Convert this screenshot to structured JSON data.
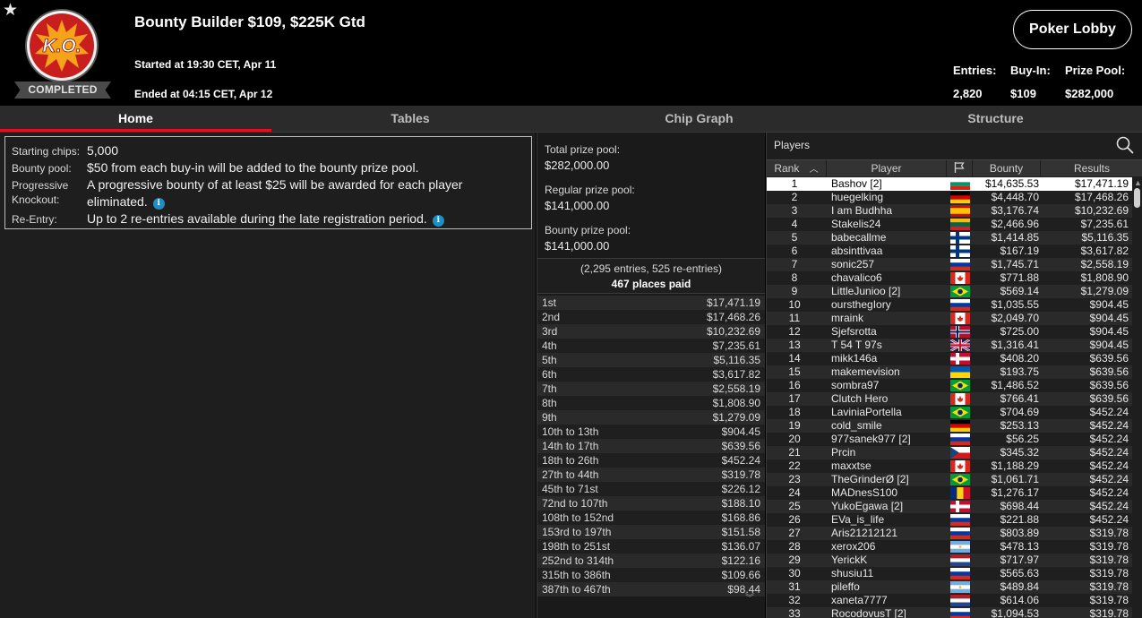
{
  "header": {
    "title": "Bounty Builder $109, $225K Gtd",
    "logo_text": "K.O.",
    "status": "COMPLETED",
    "started": "Started at 19:30 CET, Apr 11",
    "ended": "Ended at 04:15 CET, Apr 12",
    "lobby_button": "Poker Lobby",
    "stats": {
      "entries_label": "Entries:",
      "entries_value": "2,820",
      "buyin_label": "Buy-In:",
      "buyin_value": "$109",
      "prizepool_label": "Prize Pool:",
      "prizepool_value": "$282,000"
    }
  },
  "tabs": [
    "Home",
    "Tables",
    "Chip Graph",
    "Structure"
  ],
  "info": {
    "starting_chips_label": "Starting chips:",
    "starting_chips_value": "5,000",
    "bounty_pool_label": "Bounty pool:",
    "bounty_pool_value": "$50 from each buy-in will be added to the bounty prize pool.",
    "progressive_label_1": "Progressive",
    "progressive_label_2": "Knockout:",
    "progressive_value": "A progressive bounty of at least $25 will be awarded for each player eliminated.",
    "reentry_label": "Re-Entry:",
    "reentry_value": "Up to 2 re-entries available during the late registration period."
  },
  "prizes": {
    "total_label": "Total prize pool:",
    "total_value": "$282,000.00",
    "regular_label": "Regular prize pool:",
    "regular_value": "$141,000.00",
    "bounty_label": "Bounty prize pool:",
    "bounty_value": "$141,000.00",
    "entries_text": "(2,295 entries, 525 re-entries)",
    "places_text": "467 places paid",
    "payouts": [
      {
        "place": "1st",
        "amount": "$17,471.19"
      },
      {
        "place": "2nd",
        "amount": "$17,468.26"
      },
      {
        "place": "3rd",
        "amount": "$10,232.69"
      },
      {
        "place": "4th",
        "amount": "$7,235.61"
      },
      {
        "place": "5th",
        "amount": "$5,116.35"
      },
      {
        "place": "6th",
        "amount": "$3,617.82"
      },
      {
        "place": "7th",
        "amount": "$2,558.19"
      },
      {
        "place": "8th",
        "amount": "$1,808.90"
      },
      {
        "place": "9th",
        "amount": "$1,279.09"
      },
      {
        "place": "10th to 13th",
        "amount": "$904.45"
      },
      {
        "place": "14th to 17th",
        "amount": "$639.56"
      },
      {
        "place": "18th to 26th",
        "amount": "$452.24"
      },
      {
        "place": "27th to 44th",
        "amount": "$319.78"
      },
      {
        "place": "45th to 71st",
        "amount": "$226.12"
      },
      {
        "place": "72nd to 107th",
        "amount": "$188.10"
      },
      {
        "place": "108th to 152nd",
        "amount": "$168.86"
      },
      {
        "place": "153rd to 197th",
        "amount": "$151.58"
      },
      {
        "place": "198th to 251st",
        "amount": "$136.07"
      },
      {
        "place": "252nd to 314th",
        "amount": "$122.16"
      },
      {
        "place": "315th to 386th",
        "amount": "$109.66"
      },
      {
        "place": "387th to 467th",
        "amount": "$98.44"
      }
    ]
  },
  "players": {
    "title": "Players",
    "columns": {
      "rank": "Rank",
      "player": "Player",
      "bounty": "Bounty",
      "results": "Results"
    },
    "rows": [
      {
        "rank": "1",
        "name": "Bashov [2]",
        "flag": "bulgaria",
        "bounty": "$14,635.53",
        "result": "$17,471.19"
      },
      {
        "rank": "2",
        "name": "huegelking",
        "flag": "germany",
        "bounty": "$4,448.70",
        "result": "$17,468.26"
      },
      {
        "rank": "3",
        "name": "I am Budhha",
        "flag": "spain",
        "bounty": "$3,176.74",
        "result": "$10,232.69"
      },
      {
        "rank": "4",
        "name": "Stakelis24",
        "flag": "lithuania",
        "bounty": "$2,466.96",
        "result": "$7,235.61"
      },
      {
        "rank": "5",
        "name": "babecallme",
        "flag": "finland",
        "bounty": "$1,414.85",
        "result": "$5,116.35"
      },
      {
        "rank": "6",
        "name": "absinttivaa",
        "flag": "finland",
        "bounty": "$167.19",
        "result": "$3,617.82"
      },
      {
        "rank": "7",
        "name": "sonic257",
        "flag": "russia",
        "bounty": "$1,745.71",
        "result": "$2,558.19"
      },
      {
        "rank": "8",
        "name": "chavalico6",
        "flag": "canada",
        "bounty": "$771.88",
        "result": "$1,808.90"
      },
      {
        "rank": "9",
        "name": "LittleJunioo [2]",
        "flag": "brazil",
        "bounty": "$569.14",
        "result": "$1,279.09"
      },
      {
        "rank": "10",
        "name": "oursthegIory",
        "flag": "russia",
        "bounty": "$1,035.55",
        "result": "$904.45"
      },
      {
        "rank": "11",
        "name": "mraink",
        "flag": "canada",
        "bounty": "$2,049.70",
        "result": "$904.45"
      },
      {
        "rank": "12",
        "name": "Sjefsrotta",
        "flag": "norway",
        "bounty": "$725.00",
        "result": "$904.45"
      },
      {
        "rank": "13",
        "name": "T 54 T 97s",
        "flag": "uk",
        "bounty": "$1,316.41",
        "result": "$904.45"
      },
      {
        "rank": "14",
        "name": "mikk146a",
        "flag": "denmark",
        "bounty": "$408.20",
        "result": "$639.56"
      },
      {
        "rank": "15",
        "name": "makemevision",
        "flag": "ukraine",
        "bounty": "$193.75",
        "result": "$639.56"
      },
      {
        "rank": "16",
        "name": "sombra97",
        "flag": "brazil",
        "bounty": "$1,486.52",
        "result": "$639.56"
      },
      {
        "rank": "17",
        "name": "Clutch Hero",
        "flag": "canada",
        "bounty": "$766.41",
        "result": "$639.56"
      },
      {
        "rank": "18",
        "name": "LaviniaPortella",
        "flag": "brazil",
        "bounty": "$704.69",
        "result": "$452.24"
      },
      {
        "rank": "19",
        "name": "cold_smile",
        "flag": "germany",
        "bounty": "$253.13",
        "result": "$452.24"
      },
      {
        "rank": "20",
        "name": "977sanek977 [2]",
        "flag": "russia",
        "bounty": "$56.25",
        "result": "$452.24"
      },
      {
        "rank": "21",
        "name": "Prcin",
        "flag": "czech",
        "bounty": "$345.32",
        "result": "$452.24"
      },
      {
        "rank": "22",
        "name": "maxxtse",
        "flag": "canada",
        "bounty": "$1,188.29",
        "result": "$452.24"
      },
      {
        "rank": "23",
        "name": "TheGrinderØ [2]",
        "flag": "brazil",
        "bounty": "$1,061.71",
        "result": "$452.24"
      },
      {
        "rank": "24",
        "name": "MADnesS100",
        "flag": "romania",
        "bounty": "$1,276.17",
        "result": "$452.24"
      },
      {
        "rank": "25",
        "name": "YukoEgawa [2]",
        "flag": "denmark",
        "bounty": "$698.44",
        "result": "$452.24"
      },
      {
        "rank": "26",
        "name": "EVa_is_life",
        "flag": "russia",
        "bounty": "$221.88",
        "result": "$452.24"
      },
      {
        "rank": "27",
        "name": "Aris21212121",
        "flag": "russia",
        "bounty": "$803.89",
        "result": "$319.78"
      },
      {
        "rank": "28",
        "name": "xerox206",
        "flag": "argentina",
        "bounty": "$478.13",
        "result": "$319.78"
      },
      {
        "rank": "29",
        "name": "YerickK",
        "flag": "netherlands",
        "bounty": "$717.97",
        "result": "$319.78"
      },
      {
        "rank": "30",
        "name": "shusiu11",
        "flag": "russia",
        "bounty": "$565.63",
        "result": "$319.78"
      },
      {
        "rank": "31",
        "name": "pileffo",
        "flag": "argentina",
        "bounty": "$489.84",
        "result": "$319.78"
      },
      {
        "rank": "32",
        "name": "xaneta7777",
        "flag": "netherlands",
        "bounty": "$614.06",
        "result": "$319.78"
      },
      {
        "rank": "33",
        "name": "RocodovusT [2]",
        "flag": "russia",
        "bounty": "$1,094.53",
        "result": "$319.78"
      }
    ]
  }
}
